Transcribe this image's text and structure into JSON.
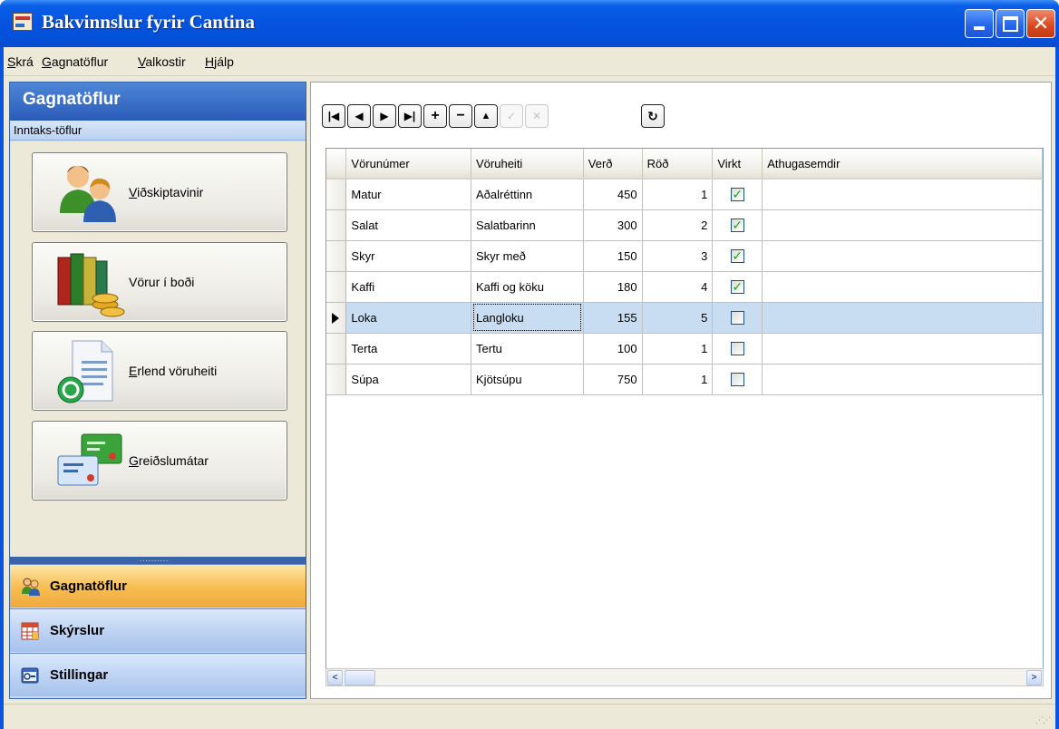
{
  "window": {
    "title": "Bakvinnslur fyrir Cantina",
    "close_glyph": "✕"
  },
  "menu": [
    {
      "accel": "S",
      "rest": "krá"
    },
    {
      "accel": "G",
      "rest": "agnatöflur"
    },
    {
      "accel": "V",
      "rest": "alkostir"
    },
    {
      "accel": "H",
      "rest": "jálp"
    }
  ],
  "nav": {
    "header": "Gagnatöflur",
    "subheader": "Inntaks-töflur",
    "buttons": [
      {
        "accel": "V",
        "rest": "iðskiptavinir",
        "icon": "customers-icon"
      },
      {
        "accel": "",
        "rest": "Vörur í boði",
        "icon": "products-icon"
      },
      {
        "accel": "E",
        "rest": "rlend vöruheiti",
        "icon": "foreign-names-icon"
      },
      {
        "accel": "G",
        "rest": "reiðslumátar",
        "icon": "payment-methods-icon"
      }
    ],
    "splitter": "..........",
    "tabs": [
      {
        "label": "Gagnatöflur",
        "icon": "people-icon",
        "active": true
      },
      {
        "label": "Skýrslur",
        "icon": "report-icon",
        "active": false
      },
      {
        "label": "Stillingar",
        "icon": "settings-icon",
        "active": false
      }
    ]
  },
  "toolbar": {
    "first": "|◀",
    "prev": "◀",
    "next": "▶",
    "last": "▶|",
    "add": "+",
    "delete": "−",
    "up": "▲",
    "post": "✓",
    "cancel": "✕",
    "refresh": "↻"
  },
  "grid": {
    "columns": [
      "Vörunúmer",
      "Vöruheiti",
      "Verð",
      "Röð",
      "Virkt",
      "Athugasemdir"
    ],
    "rows": [
      {
        "vorunumer": "Matur",
        "voruheiti": "Aðalréttinn",
        "verd": "450",
        "rod": "1",
        "virkt": true,
        "athugasemdir": ""
      },
      {
        "vorunumer": "Salat",
        "voruheiti": "Salatbarinn",
        "verd": "300",
        "rod": "2",
        "virkt": true,
        "athugasemdir": ""
      },
      {
        "vorunumer": "Skyr",
        "voruheiti": "Skyr með",
        "verd": "150",
        "rod": "3",
        "virkt": true,
        "athugasemdir": ""
      },
      {
        "vorunumer": "Kaffi",
        "voruheiti": "Kaffi og köku",
        "verd": "180",
        "rod": "4",
        "virkt": true,
        "athugasemdir": ""
      },
      {
        "vorunumer": "Loka",
        "voruheiti": "Langloku",
        "verd": "155",
        "rod": "5",
        "virkt": false,
        "athugasemdir": ""
      },
      {
        "vorunumer": "Terta",
        "voruheiti": "Tertu",
        "verd": "100",
        "rod": "1",
        "virkt": false,
        "athugasemdir": ""
      },
      {
        "vorunumer": "Súpa",
        "voruheiti": "Kjötsúpu",
        "verd": "750",
        "rod": "1",
        "virkt": false,
        "athugasemdir": ""
      }
    ],
    "selected_row": 4,
    "check_glyph": "✓"
  },
  "scrollbar": {
    "left": "<",
    "right": ">"
  },
  "colors": {
    "title_blue": "#0553e0",
    "active_tab": "#f8bf55",
    "selected_row": "#c8ddf2",
    "check_green": "#21a121"
  }
}
